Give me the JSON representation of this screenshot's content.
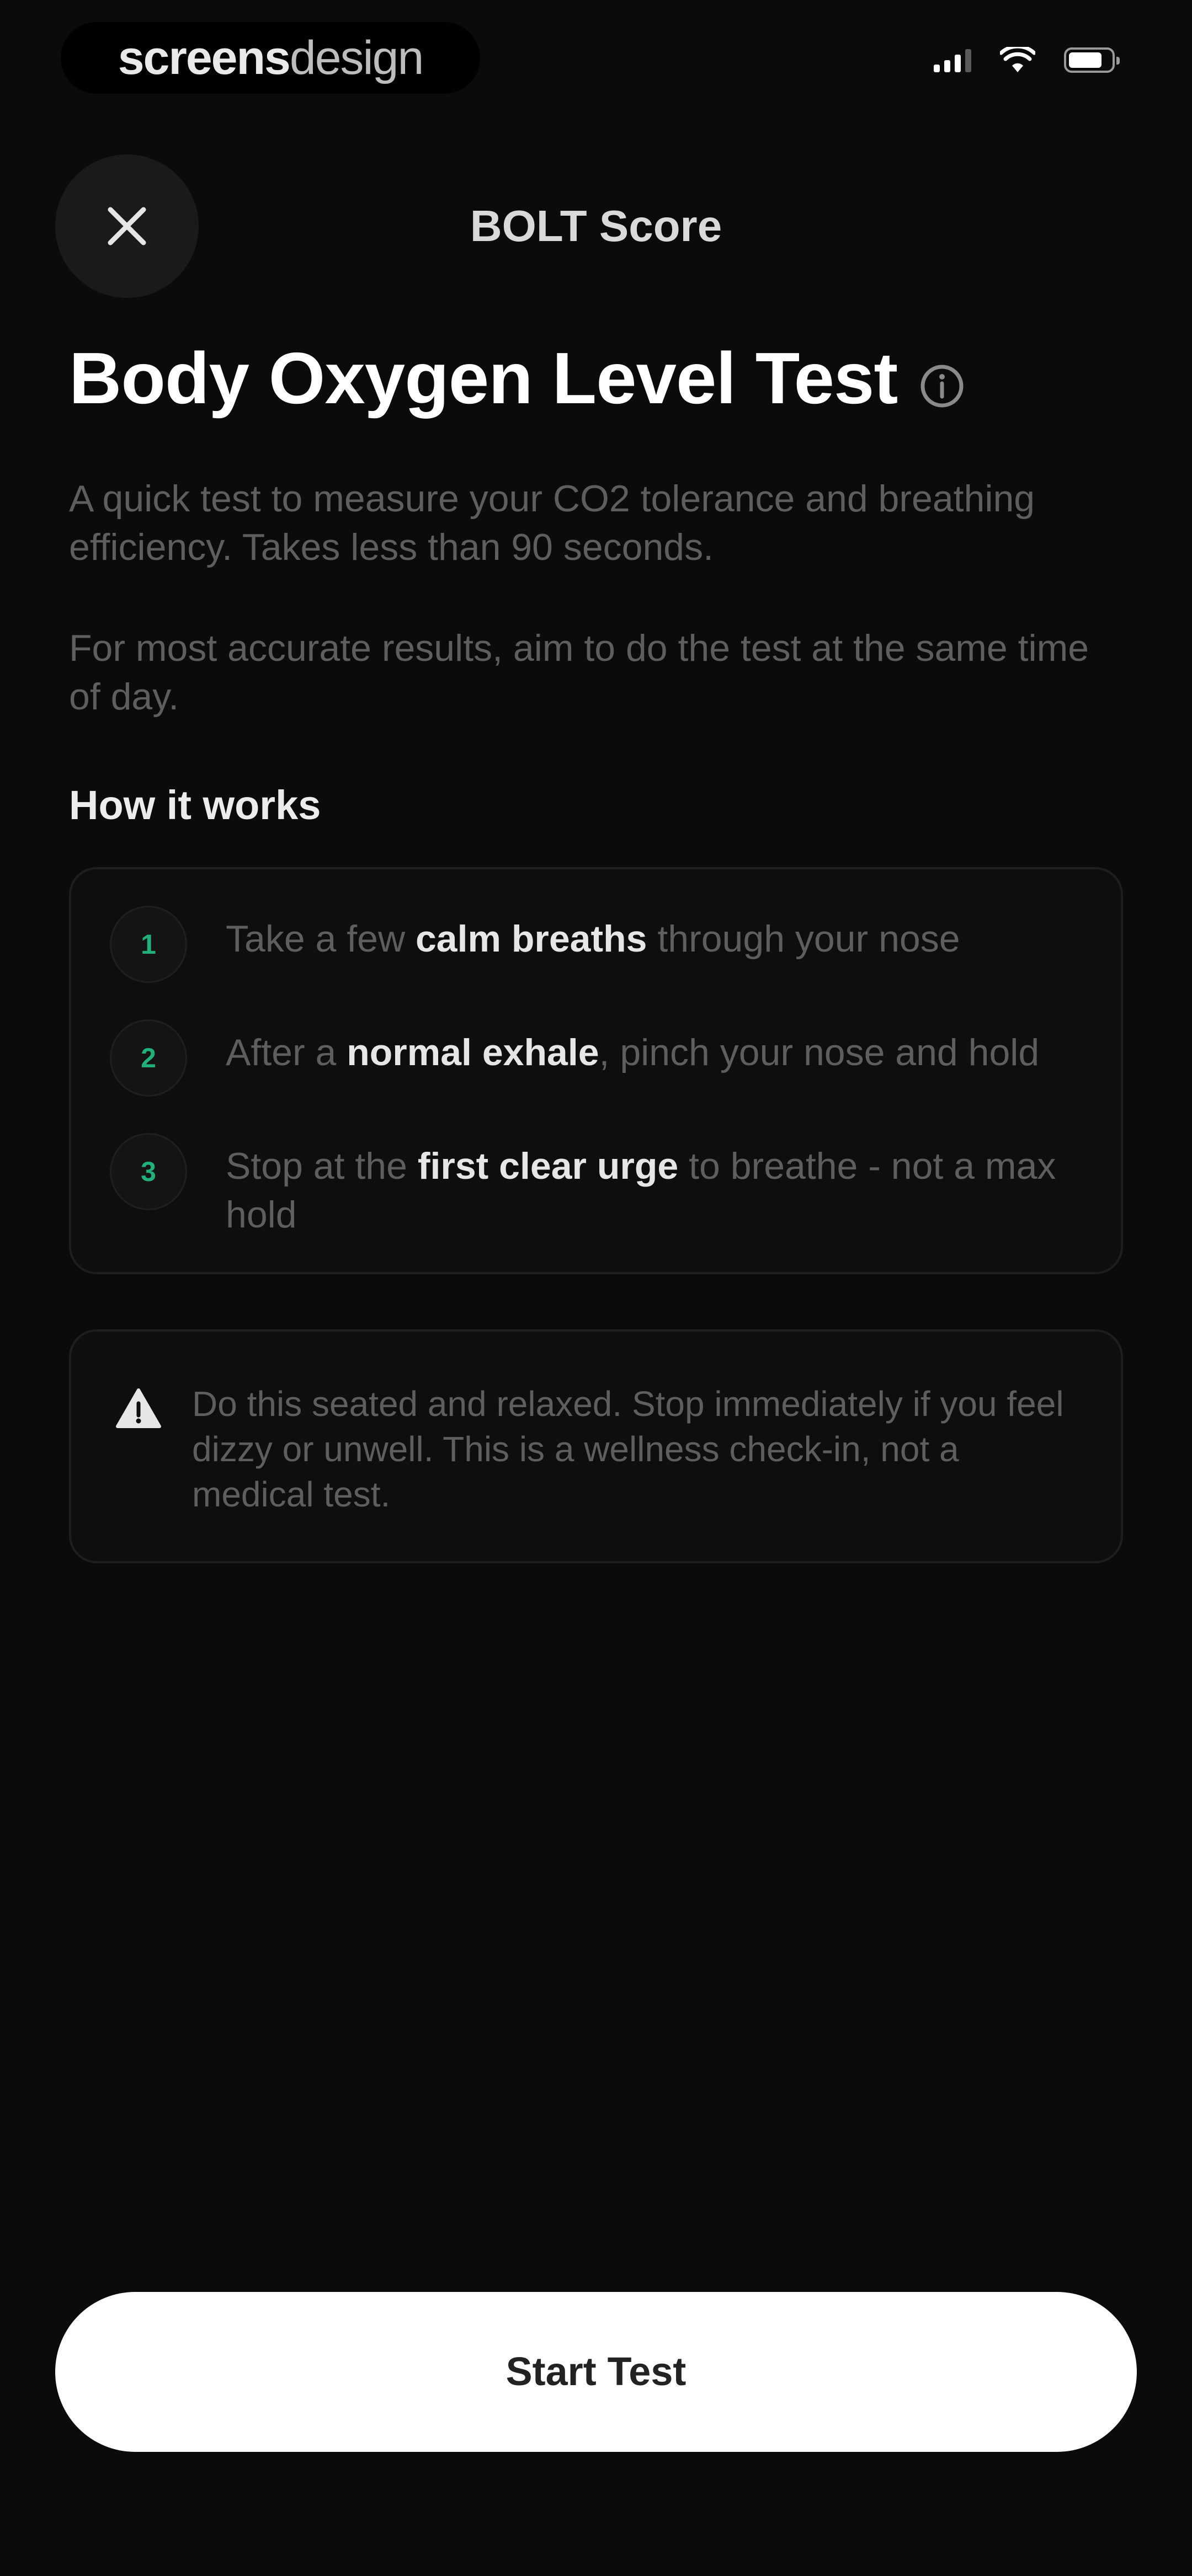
{
  "status_bar": {
    "watermark_bold": "screens",
    "watermark_light": "design",
    "icons": [
      "cellular-signal-icon",
      "wifi-icon",
      "battery-icon"
    ]
  },
  "header": {
    "title": "BOLT Score",
    "close_icon": "close-icon"
  },
  "main": {
    "title": "Body Oxygen Level Test",
    "info_icon": "info-icon",
    "intro": "A quick test to measure your CO2 tolerance and breathing efficiency. Takes less than 90 seconds.",
    "note": "For most accurate results, aim to do the test at the same time of day.",
    "how_heading": "How it works",
    "steps": [
      {
        "number": "1",
        "before": "Take a few ",
        "bold": "calm breaths",
        "after": " through your nose"
      },
      {
        "number": "2",
        "before": "After a ",
        "bold": "normal exhale",
        "after": ", pinch your nose and hold"
      },
      {
        "number": "3",
        "before": "Stop at the ",
        "bold": "first clear urge",
        "after": " to breathe - not a max hold"
      }
    ],
    "warning": "Do this seated and relaxed. Stop immediately if you feel dizzy or unwell. This is a wellness check-in, not a medical test.",
    "warning_icon": "warning-icon"
  },
  "footer": {
    "start_label": "Start Test"
  },
  "colors": {
    "background": "#0b0b0b",
    "accent_green": "#22b07a",
    "button_bg": "#ffffff"
  }
}
